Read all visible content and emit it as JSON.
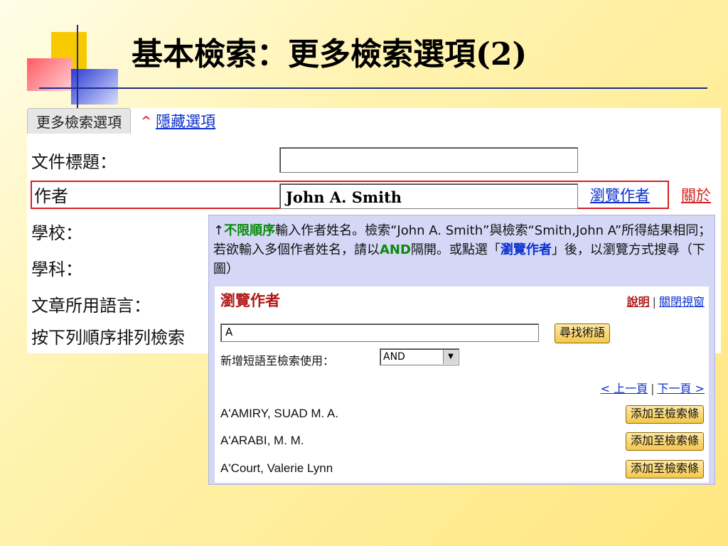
{
  "slide": {
    "title": "基本檢索：更多檢索選項(2)"
  },
  "form": {
    "tab_label": "更多檢索選項",
    "tab_caret_icon": "caret-up-icon",
    "hide_options_link": "隱藏選項",
    "labels": {
      "title": "文件標題：",
      "author": "作者",
      "school": "學校：",
      "subject": "學科：",
      "language": "文章所用語言：",
      "sort": "按下列順序排列檢索"
    },
    "title_value": "",
    "author_value": "John A. Smith",
    "browse_author_link": "瀏覽作者",
    "about_link": "關於"
  },
  "help": {
    "arrow": "↑",
    "no_order": "不限順序",
    "text1": "輸入作者姓名。檢索“John A. Smith”與檢索“Smith,John A”所得結果相同；若欲輸入多個作者姓名，請以",
    "and_word": "AND",
    "text2": "隔開。或點選「",
    "browse_word": "瀏覽作者",
    "text3": "」後，以瀏覽方式搜尋（下圖）"
  },
  "browse": {
    "title": "瀏覽作者",
    "help_link": "說明",
    "separator": "|",
    "close_link": "關閉視窗",
    "search_value": "A",
    "find_button": "尋找術語",
    "add_phrase_label": "新增短語至檢索使用：",
    "operator_selected": "AND",
    "prev_page": "< 上一頁",
    "next_page": "下一頁 >",
    "results": [
      {
        "name": "A'AMIRY, SUAD M. A.",
        "button": "添加至檢索條"
      },
      {
        "name": "A'ARABI, M. M.",
        "button": "添加至檢索條"
      },
      {
        "name": "A'Court, Valerie Lynn",
        "button": "添加至檢索條"
      }
    ]
  },
  "colors": {
    "link_blue": "#0b2fcf",
    "highlight_red": "#d92020",
    "green": "#0a8a0a",
    "overlay_bg": "#d4d7f6"
  }
}
